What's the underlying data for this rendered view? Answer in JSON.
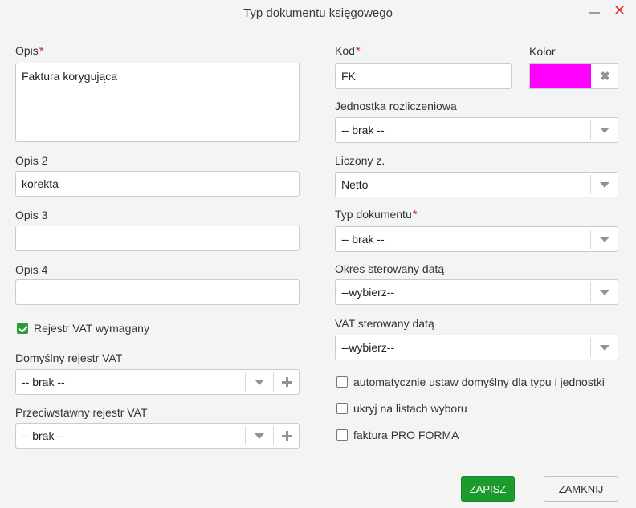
{
  "window": {
    "title": "Typ dokumentu księgowego"
  },
  "left": {
    "opis": {
      "label": "Opis",
      "value": "Faktura korygująca"
    },
    "opis2": {
      "label": "Opis 2",
      "value": "korekta"
    },
    "opis3": {
      "label": "Opis 3",
      "value": ""
    },
    "opis4": {
      "label": "Opis 4",
      "value": ""
    },
    "rejestr_vat": {
      "label": "Rejestr VAT wymagany",
      "checked": true
    },
    "domyslny": {
      "label": "Domyślny rejestr VAT",
      "value": "-- brak --"
    },
    "przeciwstawny": {
      "label": "Przeciwstawny rejestr VAT",
      "value": "-- brak --"
    }
  },
  "right": {
    "kod": {
      "label": "Kod",
      "value": "FK"
    },
    "kolor": {
      "label": "Kolor",
      "color": "#ff00ff"
    },
    "jednostka": {
      "label": "Jednostka rozliczeniowa",
      "value": "-- brak --"
    },
    "liczony": {
      "label": "Liczony z.",
      "value": "Netto"
    },
    "typ": {
      "label": "Typ dokumentu",
      "value": "-- brak --"
    },
    "okres": {
      "label": "Okres sterowany datą",
      "value": "--wybierz--"
    },
    "vat": {
      "label": "VAT sterowany datą",
      "value": "--wybierz--"
    },
    "checks": [
      {
        "label": "automatycznie ustaw domyślny dla typu i jednostki",
        "checked": false
      },
      {
        "label": "ukryj na listach wyboru",
        "checked": false
      },
      {
        "label": "faktura PRO FORMA",
        "checked": false
      }
    ]
  },
  "required_mark": "*",
  "footer": {
    "save": "ZAPISZ",
    "close": "ZAMKNIJ"
  },
  "colors": {
    "accent": "#1e9a2c",
    "required": "#e02020",
    "close_icon": "#e03030"
  }
}
